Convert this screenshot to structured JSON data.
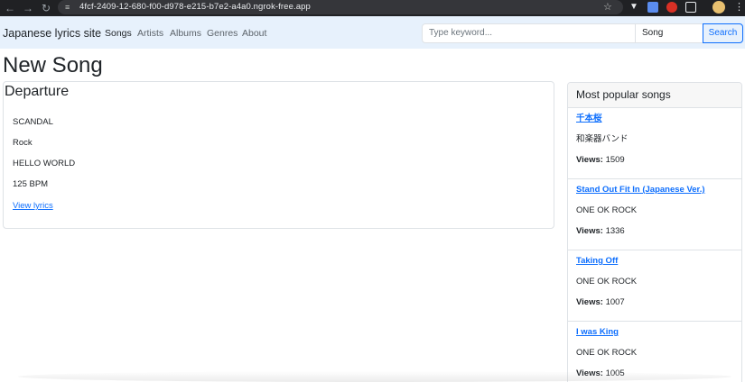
{
  "browser": {
    "url": "4fcf-2409-12-680-f00-d978-e215-b7e2-a4a0.ngrok-free.app"
  },
  "navbar": {
    "brand": "Japanese lyrics site",
    "links": [
      {
        "label": "Songs",
        "active": true
      },
      {
        "label": "Artists",
        "active": false
      },
      {
        "label": "Albums",
        "active": false
      },
      {
        "label": "Genres",
        "active": false
      },
      {
        "label": "About",
        "active": false
      }
    ],
    "search": {
      "placeholder": "Type keyword...",
      "type_selected": "Song",
      "button_label": "Search"
    }
  },
  "main": {
    "page_title": "New Song",
    "song": {
      "title": "Departure",
      "artist": "SCANDAL",
      "genre": "Rock",
      "album": "HELLO WORLD",
      "tempo": "125 BPM",
      "link_label": "View lyrics"
    }
  },
  "sidebar": {
    "title": "Most popular songs",
    "views_label": "Views:",
    "items": [
      {
        "title": "千本桜",
        "artist": "和楽器バンド",
        "views": "1509"
      },
      {
        "title": "Stand Out Fit In (Japanese Ver.)",
        "artist": "ONE OK ROCK",
        "views": "1336"
      },
      {
        "title": "Taking Off",
        "artist": "ONE OK ROCK",
        "views": "1007"
      },
      {
        "title": "I was King",
        "artist": "ONE OK ROCK",
        "views": "1005"
      }
    ]
  },
  "colors": {
    "navbar_bg": "#e7f1fc",
    "link": "#0d6efd",
    "chrome_bg": "#202124"
  }
}
